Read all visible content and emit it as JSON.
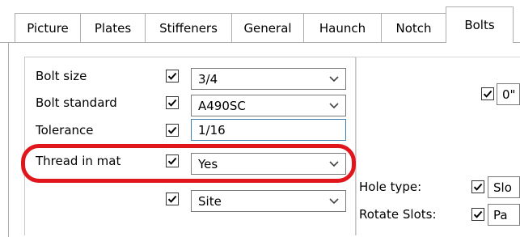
{
  "tabs": [
    {
      "label": "Picture"
    },
    {
      "label": "Plates"
    },
    {
      "label": "Stiffeners"
    },
    {
      "label": "General"
    },
    {
      "label": "Haunch"
    },
    {
      "label": "Notch"
    },
    {
      "label": "Bolts"
    }
  ],
  "active_tab": "Bolts",
  "rows": [
    {
      "label": "Bolt size",
      "checked": true,
      "value": "3/4",
      "control": "combo"
    },
    {
      "label": "Bolt standard",
      "checked": true,
      "value": "A490SC",
      "control": "combo"
    },
    {
      "label": "Tolerance",
      "checked": true,
      "value": "1/16",
      "control": "textbox"
    },
    {
      "label": "Thread in mat",
      "checked": true,
      "value": "Yes",
      "control": "combo"
    },
    {
      "label": "",
      "checked": true,
      "value": "Site",
      "control": "combo"
    }
  ],
  "right": {
    "offset_value": "0\"",
    "hole_type_label": "Hole type:",
    "hole_type_value": "Slo",
    "rotate_slots_label": "Rotate Slots:",
    "rotate_slots_value": "Pa"
  },
  "colors": {
    "highlight": "#e1161c",
    "focus_border": "#3c7fb1"
  }
}
